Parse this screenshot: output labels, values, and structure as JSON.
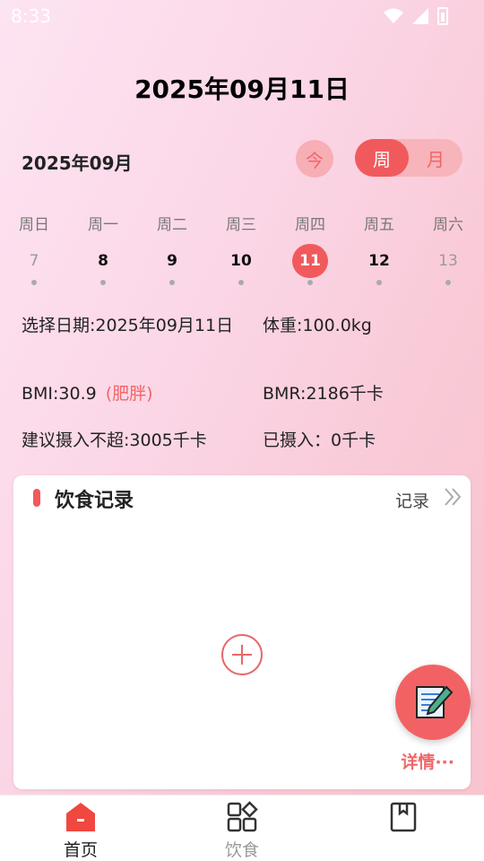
{
  "status_bar": {
    "time": "8:33"
  },
  "header": {
    "date": "2025年09月11日"
  },
  "calendar": {
    "month_label": "2025年09月",
    "today_label": "今",
    "view_week_label": "周",
    "view_month_label": "月",
    "weekdays": [
      "周日",
      "周一",
      "周二",
      "周三",
      "周四",
      "周五",
      "周六"
    ],
    "days": [
      {
        "num": "7",
        "muted": true,
        "selected": false
      },
      {
        "num": "8",
        "muted": false,
        "selected": false
      },
      {
        "num": "9",
        "muted": false,
        "selected": false
      },
      {
        "num": "10",
        "muted": false,
        "selected": false
      },
      {
        "num": "11",
        "muted": false,
        "selected": true
      },
      {
        "num": "12",
        "muted": false,
        "selected": false
      },
      {
        "num": "13",
        "muted": true,
        "selected": false
      }
    ]
  },
  "info": {
    "selected_date": "选择日期:2025年09月11日",
    "weight": "体重:100.0kg",
    "bmi": "BMI:30.9",
    "bmi_tag": "(肥胖)",
    "bmr": "BMR:2186千卡",
    "suggested": "建议摄入不超:3005千卡",
    "consumed": "已摄入：0千卡"
  },
  "diet_card": {
    "title": "饮食记录",
    "record_link": "记录",
    "detail_link": "详情···"
  },
  "tabbar": {
    "tabs": [
      {
        "label": "首页",
        "icon": "home-icon",
        "active": true
      },
      {
        "label": "饮食",
        "icon": "grid-icon",
        "active": false
      },
      {
        "label": "",
        "icon": "book-icon",
        "active": false
      }
    ]
  },
  "colors": {
    "accent": "#f15a5d",
    "accent_light": "#f7aeb5",
    "text_dark": "#222222",
    "muted": "#999999"
  }
}
